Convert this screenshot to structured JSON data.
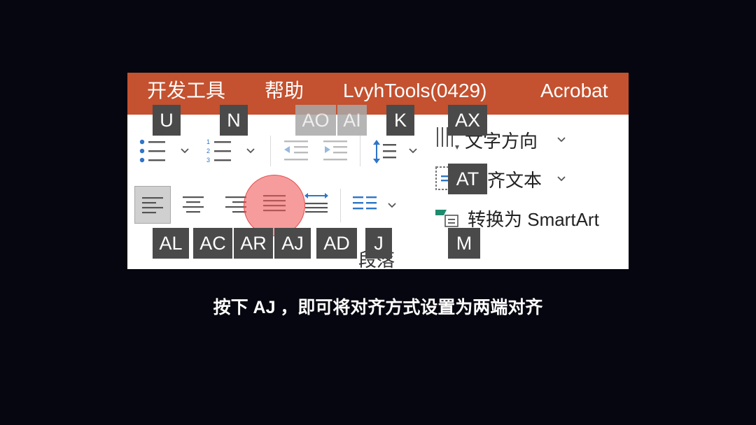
{
  "ribbon": {
    "tabs": [
      "开发工具",
      "帮助",
      "LvyhTools(0429)",
      "Acrobat"
    ],
    "group_label": "段落",
    "commands": {
      "text_direction": "文字方向",
      "align_text": "齐文本",
      "convert_smartart": "转换为 SmartArt"
    },
    "keytips": {
      "bullets": "U",
      "numbering": "N",
      "decrease_indent": "AO",
      "increase_indent": "AI",
      "line_spacing": "K",
      "text_direction": "AX",
      "align_text": "AT",
      "align_left": "AL",
      "center": "AC",
      "align_right": "AR",
      "justify": "AJ",
      "distributed": "AD",
      "columns": "J",
      "smartart": "M"
    },
    "icons": {
      "bullets": "bulleted-list-icon",
      "numbering": "numbered-list-icon",
      "decrease_indent": "decrease-indent-icon",
      "increase_indent": "increase-indent-icon",
      "line_spacing": "line-spacing-icon",
      "text_direction": "text-direction-icon",
      "align_text": "align-text-icon",
      "align_left": "align-left-icon",
      "center": "align-center-icon",
      "align_right": "align-right-icon",
      "justify": "justify-icon",
      "distributed": "distributed-icon",
      "columns": "columns-icon",
      "smartart": "smartart-icon"
    },
    "colors": {
      "tab_bar": "#c4512f",
      "keytip": "#4a4a4a",
      "highlight": "#f05a5a",
      "accent_blue": "#2e75c8",
      "background": "#05060f"
    }
  },
  "caption": "按下 AJ ，即可将对齐方式设置为两端对齐"
}
